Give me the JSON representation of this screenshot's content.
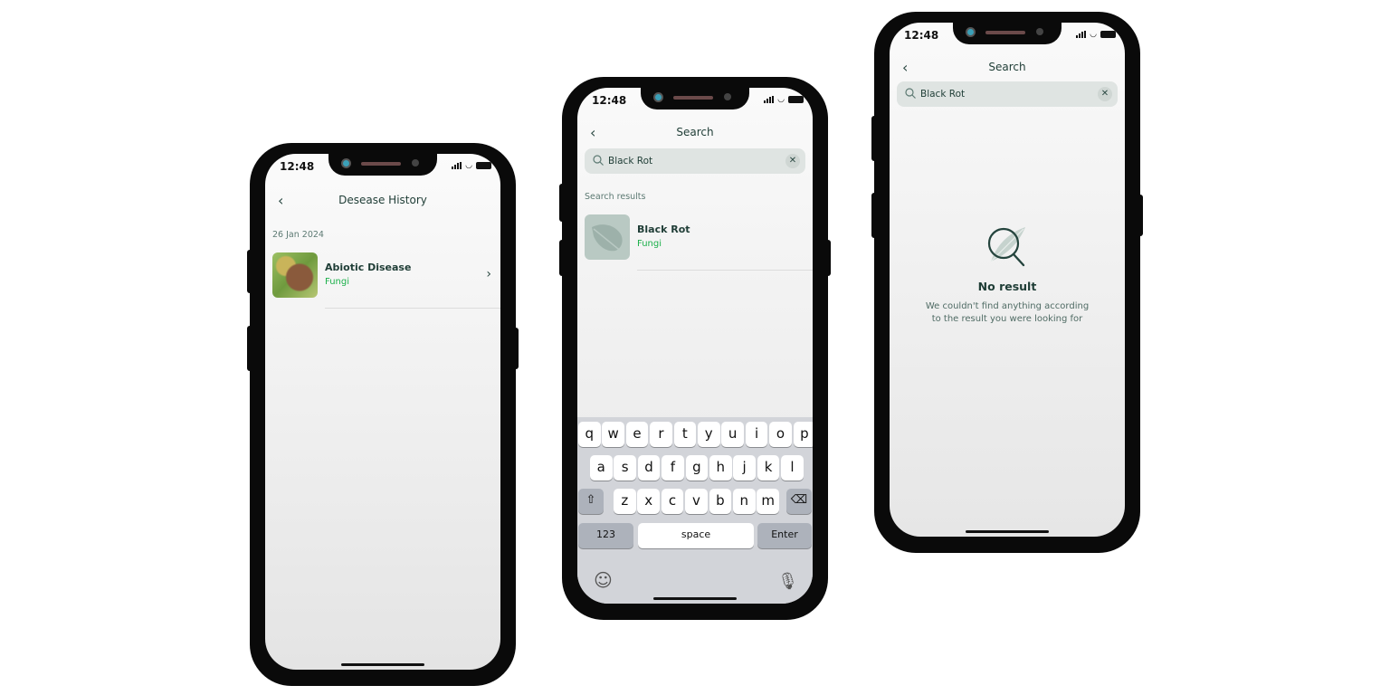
{
  "status_bar": {
    "time": "12:48"
  },
  "screens": {
    "history": {
      "title": "Desease History",
      "date_header": "26 Jan 2024",
      "items": [
        {
          "name": "Abiotic Disease",
          "category": "Fungi"
        }
      ]
    },
    "search_results": {
      "title": "Search",
      "search_value": "Black Rot",
      "section_label": "Search results",
      "results": [
        {
          "name": "Black Rot",
          "category": "Fungi"
        }
      ],
      "keyboard": {
        "row1": [
          "q",
          "w",
          "e",
          "r",
          "t",
          "y",
          "u",
          "i",
          "o",
          "p"
        ],
        "row2": [
          "a",
          "s",
          "d",
          "f",
          "g",
          "h",
          "j",
          "k",
          "l"
        ],
        "row3": [
          "z",
          "x",
          "c",
          "v",
          "b",
          "n",
          "m"
        ],
        "numbers_label": "123",
        "space_label": "space",
        "enter_label": "Enter"
      }
    },
    "no_result": {
      "title": "Search",
      "search_value": "Black Rot",
      "empty_title": "No result",
      "empty_line1": "We couldn't find anything according",
      "empty_line2": "to the result you were looking for"
    }
  },
  "colors": {
    "accent_green": "#1bb04a",
    "text_dark": "#1f3d36",
    "search_bg": "#dfe4e2"
  }
}
